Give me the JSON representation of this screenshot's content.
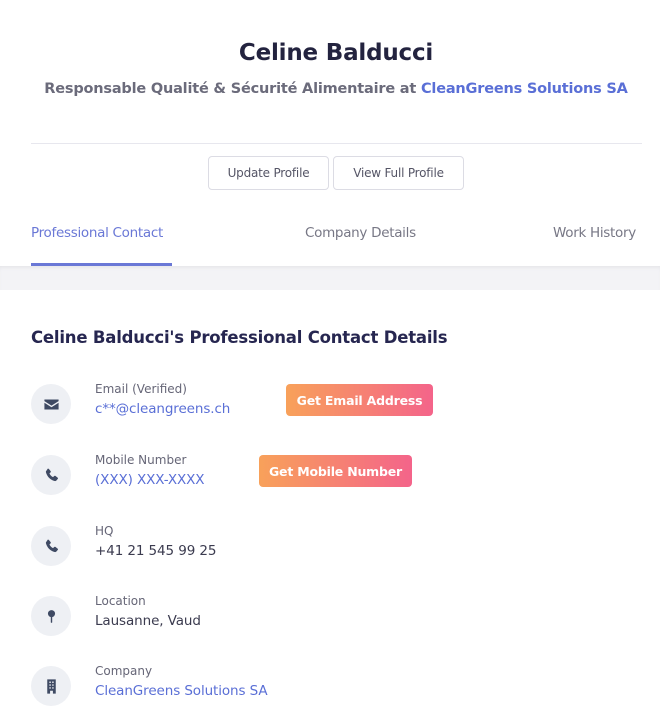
{
  "profile": {
    "name": "Celine Balducci",
    "headline_prefix": "Responsable Qualité & Sécurité Alimentaire at",
    "company": "CleanGreens Solutions SA"
  },
  "actions": {
    "update_label": "Update Profile",
    "view_label": "View Full Profile"
  },
  "tabs": [
    {
      "label": "Professional Contact",
      "active": true
    },
    {
      "label": "Company Details",
      "active": false
    },
    {
      "label": "Work History",
      "active": false
    }
  ],
  "section": {
    "title": "Celine Balducci's Professional Contact Details"
  },
  "contact": {
    "email": {
      "label": "Email (Verified)",
      "value": "c**@cleangreens.ch",
      "button": "Get Email Address",
      "icon": "envelope-icon"
    },
    "mobile": {
      "label": "Mobile Number",
      "value": "(XXX) XXX-XXXX",
      "button": "Get Mobile Number",
      "icon": "phone-icon"
    },
    "hq": {
      "label": "HQ",
      "value": "+41 21 545 99 25",
      "icon": "phone-icon"
    },
    "location": {
      "label": "Location",
      "value": "Lausanne, Vaud",
      "icon": "map-pin-icon"
    },
    "company": {
      "label": "Company",
      "value": "CleanGreens Solutions SA",
      "icon": "building-icon"
    }
  },
  "colors": {
    "accent": "#5a6fd6",
    "gradient_start": "#f8a15a",
    "gradient_end": "#f4648a",
    "text_dark": "#23233f"
  }
}
